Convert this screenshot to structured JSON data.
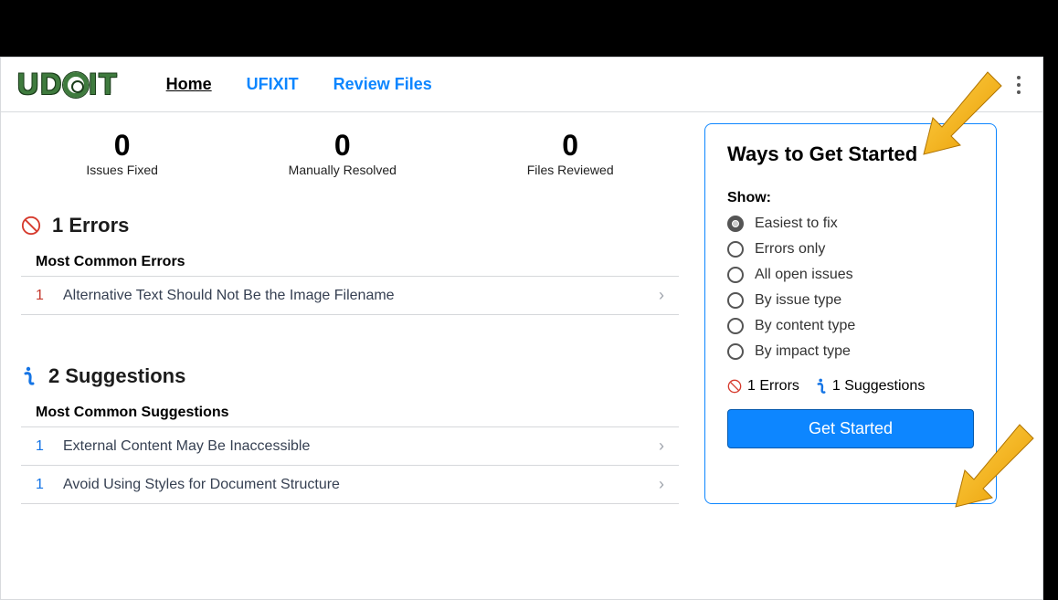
{
  "brand": {
    "name": "UDOIT"
  },
  "nav": {
    "home": "Home",
    "ufixit": "UFIXIT",
    "review": "Review Files"
  },
  "stats": {
    "fixed": {
      "num": "0",
      "label": "Issues Fixed"
    },
    "resolved": {
      "num": "0",
      "label": "Manually Resolved"
    },
    "files": {
      "num": "0",
      "label": "Files Reviewed"
    }
  },
  "errors": {
    "title": "1 Errors",
    "subhead": "Most Common Errors",
    "rows": [
      {
        "count": "1",
        "label": "Alternative Text Should Not Be the Image Filename"
      }
    ]
  },
  "suggestions": {
    "title": "2 Suggestions",
    "subhead": "Most Common Suggestions",
    "rows": [
      {
        "count": "1",
        "label": "External Content May Be Inaccessible"
      },
      {
        "count": "1",
        "label": "Avoid Using Styles for Document Structure"
      }
    ]
  },
  "panel": {
    "heading": "Ways to Get Started",
    "showLabel": "Show:",
    "options": [
      "Easiest to fix",
      "Errors only",
      "All open issues",
      "By issue type",
      "By content type",
      "By impact type"
    ],
    "summary": {
      "errors": "1 Errors",
      "suggestions": "1 Suggestions"
    },
    "cta": "Get Started"
  }
}
